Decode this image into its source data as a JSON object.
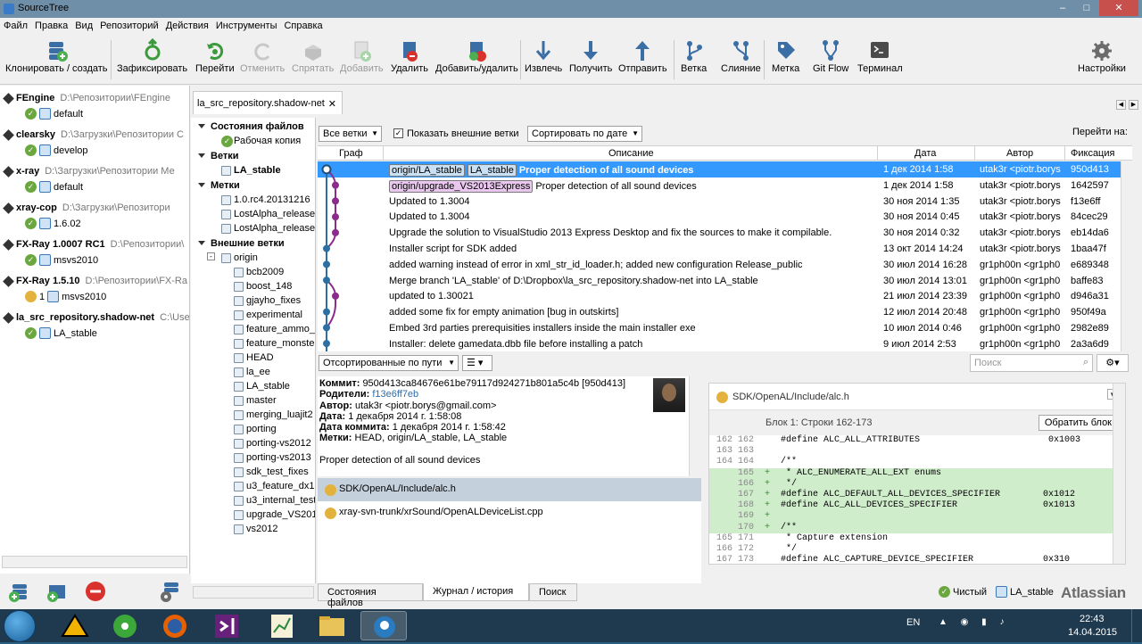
{
  "app": {
    "title": "SourceTree"
  },
  "menu": [
    "Файл",
    "Правка",
    "Вид",
    "Репозиторий",
    "Действия",
    "Инструменты",
    "Справка"
  ],
  "toolbar": [
    {
      "label": "Клонировать / создать",
      "icon": "clone-icon",
      "enabled": true
    },
    {
      "label": "Зафиксировать",
      "icon": "commit-icon",
      "enabled": true
    },
    {
      "label": "Перейти",
      "icon": "checkout-icon",
      "enabled": true
    },
    {
      "label": "Отменить",
      "icon": "discard-icon",
      "enabled": false
    },
    {
      "label": "Спрятать",
      "icon": "stash-icon",
      "enabled": false
    },
    {
      "label": "Добавить",
      "icon": "add-icon",
      "enabled": false
    },
    {
      "label": "Удалить",
      "icon": "remove-icon",
      "enabled": true
    },
    {
      "label": "Добавить/удалить",
      "icon": "add-remove-icon",
      "enabled": true
    },
    {
      "label": "Извлечь",
      "icon": "fetch-icon",
      "enabled": true
    },
    {
      "label": "Получить",
      "icon": "pull-icon",
      "enabled": true
    },
    {
      "label": "Отправить",
      "icon": "push-icon",
      "enabled": true
    },
    {
      "label": "Ветка",
      "icon": "branch-icon",
      "enabled": true
    },
    {
      "label": "Слияние",
      "icon": "merge-icon",
      "enabled": true
    },
    {
      "label": "Метка",
      "icon": "tag-icon",
      "enabled": true
    },
    {
      "label": "Git Flow",
      "icon": "git-flow-icon",
      "enabled": true
    },
    {
      "label": "Терминал",
      "icon": "terminal-icon",
      "enabled": true
    },
    {
      "label": "Настройки",
      "icon": "settings-icon",
      "enabled": true
    }
  ],
  "repos": [
    {
      "name": "FEngine",
      "path": "D:\\Репозитории\\FEngine",
      "status": "clean",
      "branch": "default"
    },
    {
      "name": "clearsky",
      "path": "D:\\Загрузки\\Репозитории С",
      "status": "clean",
      "branch": "develop"
    },
    {
      "name": "x-ray",
      "path": "D:\\Загрузки\\Репозитории Ме",
      "status": "clean",
      "branch": "default"
    },
    {
      "name": "xray-cop",
      "path": "D:\\Загрузки\\Репозитори",
      "status": "clean",
      "branch": "1.6.02"
    },
    {
      "name": "FX-Ray 1.0007 RC1",
      "path": "D:\\Репозитории\\",
      "status": "clean",
      "branch": "msvs2010"
    },
    {
      "name": "FX-Ray 1.5.10",
      "path": "D:\\Репозитории\\FX-Ra",
      "status": "changes",
      "count": "1",
      "branch": "msvs2010"
    },
    {
      "name": "la_src_repository.shadow-net",
      "path": "C:\\Use",
      "status": "clean",
      "branch": "LA_stable"
    }
  ],
  "tab": {
    "title": "la_src_repository.shadow-net"
  },
  "nav": {
    "file_status": "Состояния файлов",
    "working_copy": "Рабочая копия",
    "branches": "Ветки",
    "branch_items": [
      "LA_stable"
    ],
    "tags": "Метки",
    "tag_items": [
      "1.0.rc4.20131216",
      "LostAlpha_release",
      "LostAlpha_release"
    ],
    "remotes": "Внешние ветки",
    "remote_name": "origin",
    "remote_items": [
      "bcb2009",
      "boost_148",
      "gjayho_fixes",
      "experimental",
      "feature_ammo_l",
      "feature_monste",
      "HEAD",
      "la_ee",
      "LA_stable",
      "master",
      "merging_luajit2",
      "porting",
      "porting-vs2012",
      "porting-vs2013",
      "sdk_test_fixes",
      "u3_feature_dx10",
      "u3_internal_test",
      "upgrade_VS201",
      "vs2012"
    ]
  },
  "filters": {
    "branches": "Все ветки",
    "show_remote": "Показать внешние ветки",
    "sort": "Сортировать по дате",
    "jump": "Перейти на:"
  },
  "columns": {
    "graph": "Граф",
    "desc": "Описание",
    "date": "Дата",
    "author": "Автор",
    "commit": "Фиксация"
  },
  "commits": [
    {
      "labels": [
        {
          "t": "origin/LA_stable",
          "c": "b"
        },
        {
          "t": "LA_stable",
          "c": "b"
        }
      ],
      "desc": "Proper detection of all sound devices",
      "date": "1 дек 2014 1:58",
      "author": "utak3r <piotr.borys",
      "hash": "950d413",
      "selected": true
    },
    {
      "labels": [
        {
          "t": "origin/upgrade_VS2013Express",
          "c": "p"
        }
      ],
      "desc": "Proper detection of all sound devices",
      "date": "1 дек 2014 1:58",
      "author": "utak3r <piotr.borys",
      "hash": "1642597"
    },
    {
      "labels": [],
      "desc": "Updated to 1.3004",
      "date": "30 ноя 2014 1:35",
      "author": "utak3r <piotr.borys",
      "hash": "f13e6ff"
    },
    {
      "labels": [],
      "desc": "Updated to 1.3004",
      "date": "30 ноя 2014 0:45",
      "author": "utak3r <piotr.borys",
      "hash": "84cec29"
    },
    {
      "labels": [],
      "desc": "Upgrade the solution to VisualStudio 2013 Express Desktop and fix the sources to make it compilable.",
      "date": "30 ноя 2014 0:32",
      "author": "utak3r <piotr.borys",
      "hash": "eb14da6"
    },
    {
      "labels": [],
      "desc": "Installer script for SDK added",
      "date": "13 окт 2014 14:24",
      "author": "utak3r <piotr.borys",
      "hash": "1baa47f"
    },
    {
      "labels": [],
      "desc": "added warning instead of error in xml_str_id_loader.h; added new configuration Release_public",
      "date": "30 июл 2014 16:28",
      "author": "gr1ph00n <gr1ph0",
      "hash": "e689348"
    },
    {
      "labels": [],
      "desc": "Merge branch 'LA_stable' of D:\\Dropbox\\la_src_repository.shadow-net into LA_stable",
      "date": "30 июл 2014 13:01",
      "author": "gr1ph00n <gr1ph0",
      "hash": "baffe83"
    },
    {
      "labels": [],
      "desc": "updated to 1.30021",
      "date": "21 июл 2014 23:39",
      "author": "gr1ph00n <gr1ph0",
      "hash": "d946a31"
    },
    {
      "labels": [],
      "desc": "added some fix for empty animation [bug in outskirts]",
      "date": "12 июл 2014 20:48",
      "author": "gr1ph00n <gr1ph0",
      "hash": "950f49a"
    },
    {
      "labels": [],
      "desc": "Embed 3rd parties prerequisities installers inside the main installer exe",
      "date": "10 июл 2014 0:46",
      "author": "gr1ph00n <gr1ph0",
      "hash": "2982e89"
    },
    {
      "labels": [],
      "desc": "Installer: delete gamedata.dbb file before installing a patch",
      "date": "9 июл 2014 2:53",
      "author": "gr1ph00n <gr1ph0",
      "hash": "2a3a6d9"
    }
  ],
  "files_filter": "Отсортированные по пути",
  "search_placeholder": "Поиск",
  "detail": {
    "commit_label": "Коммит:",
    "commit": "950d413ca84676e61be79117d924271b801a5c4b [950d413]",
    "parents_label": "Родители:",
    "parents": "f13e6ff7eb",
    "author_label": "Автор:",
    "author": "utak3r <piotr.borys@gmail.com>",
    "date_label": "Дата:",
    "date": "1 декабря 2014 г. 1:58:08",
    "cdate_label": "Дата коммита:",
    "cdate": "1 декабря 2014 г. 1:58:42",
    "tags_label": "Метки:",
    "tags": "HEAD, origin/LA_stable, LA_stable",
    "message": "Proper detection of all sound devices"
  },
  "changed_files": [
    {
      "path": "SDK/OpenAL/Include/alc.h",
      "selected": true
    },
    {
      "path": "xray-svn-trunk/xrSound/OpenALDeviceList.cpp",
      "selected": false
    }
  ],
  "diff": {
    "file": "SDK/OpenAL/Include/alc.h",
    "hunk": "Блок 1: Строки 162-173",
    "revert": "Обратить блок",
    "lines": [
      {
        "o": "162",
        "n": "162",
        "p": "",
        "t": "#define ALC_ALL_ATTRIBUTES                        0x1003",
        "add": false
      },
      {
        "o": "163",
        "n": "163",
        "p": "",
        "t": "",
        "add": false
      },
      {
        "o": "164",
        "n": "164",
        "p": "",
        "t": "/**",
        "add": false
      },
      {
        "o": "",
        "n": "165",
        "p": "+",
        "t": " * ALC_ENUMERATE_ALL_EXT enums",
        "add": true
      },
      {
        "o": "",
        "n": "166",
        "p": "+",
        "t": " */",
        "add": true
      },
      {
        "o": "",
        "n": "167",
        "p": "+",
        "t": "#define ALC_DEFAULT_ALL_DEVICES_SPECIFIER        0x1012",
        "add": true
      },
      {
        "o": "",
        "n": "168",
        "p": "+",
        "t": "#define ALC_ALL_DEVICES_SPECIFIER                0x1013",
        "add": true
      },
      {
        "o": "",
        "n": "169",
        "p": "+",
        "t": "",
        "add": true
      },
      {
        "o": "",
        "n": "170",
        "p": "+",
        "t": "/**",
        "add": true
      },
      {
        "o": "165",
        "n": "171",
        "p": "",
        "t": " * Capture extension",
        "add": false
      },
      {
        "o": "166",
        "n": "172",
        "p": "",
        "t": " */",
        "add": false
      },
      {
        "o": "167",
        "n": "173",
        "p": "",
        "t": "#define ALC_CAPTURE_DEVICE_SPECIFIER             0x310",
        "add": false
      }
    ]
  },
  "bottom_tabs": [
    "Состояния файлов",
    "Журнал / история",
    "Поиск"
  ],
  "status": {
    "clean": "Чистый",
    "branch": "LA_stable",
    "brand": "Atlassian"
  },
  "tray": {
    "lang": "EN",
    "time": "22:43",
    "date": "14.04.2015"
  },
  "colors": {
    "selection": "#3399ff",
    "graph_blue": "#2d6fa3",
    "graph_purple": "#8a2d8a",
    "added": "#cfeccb"
  }
}
